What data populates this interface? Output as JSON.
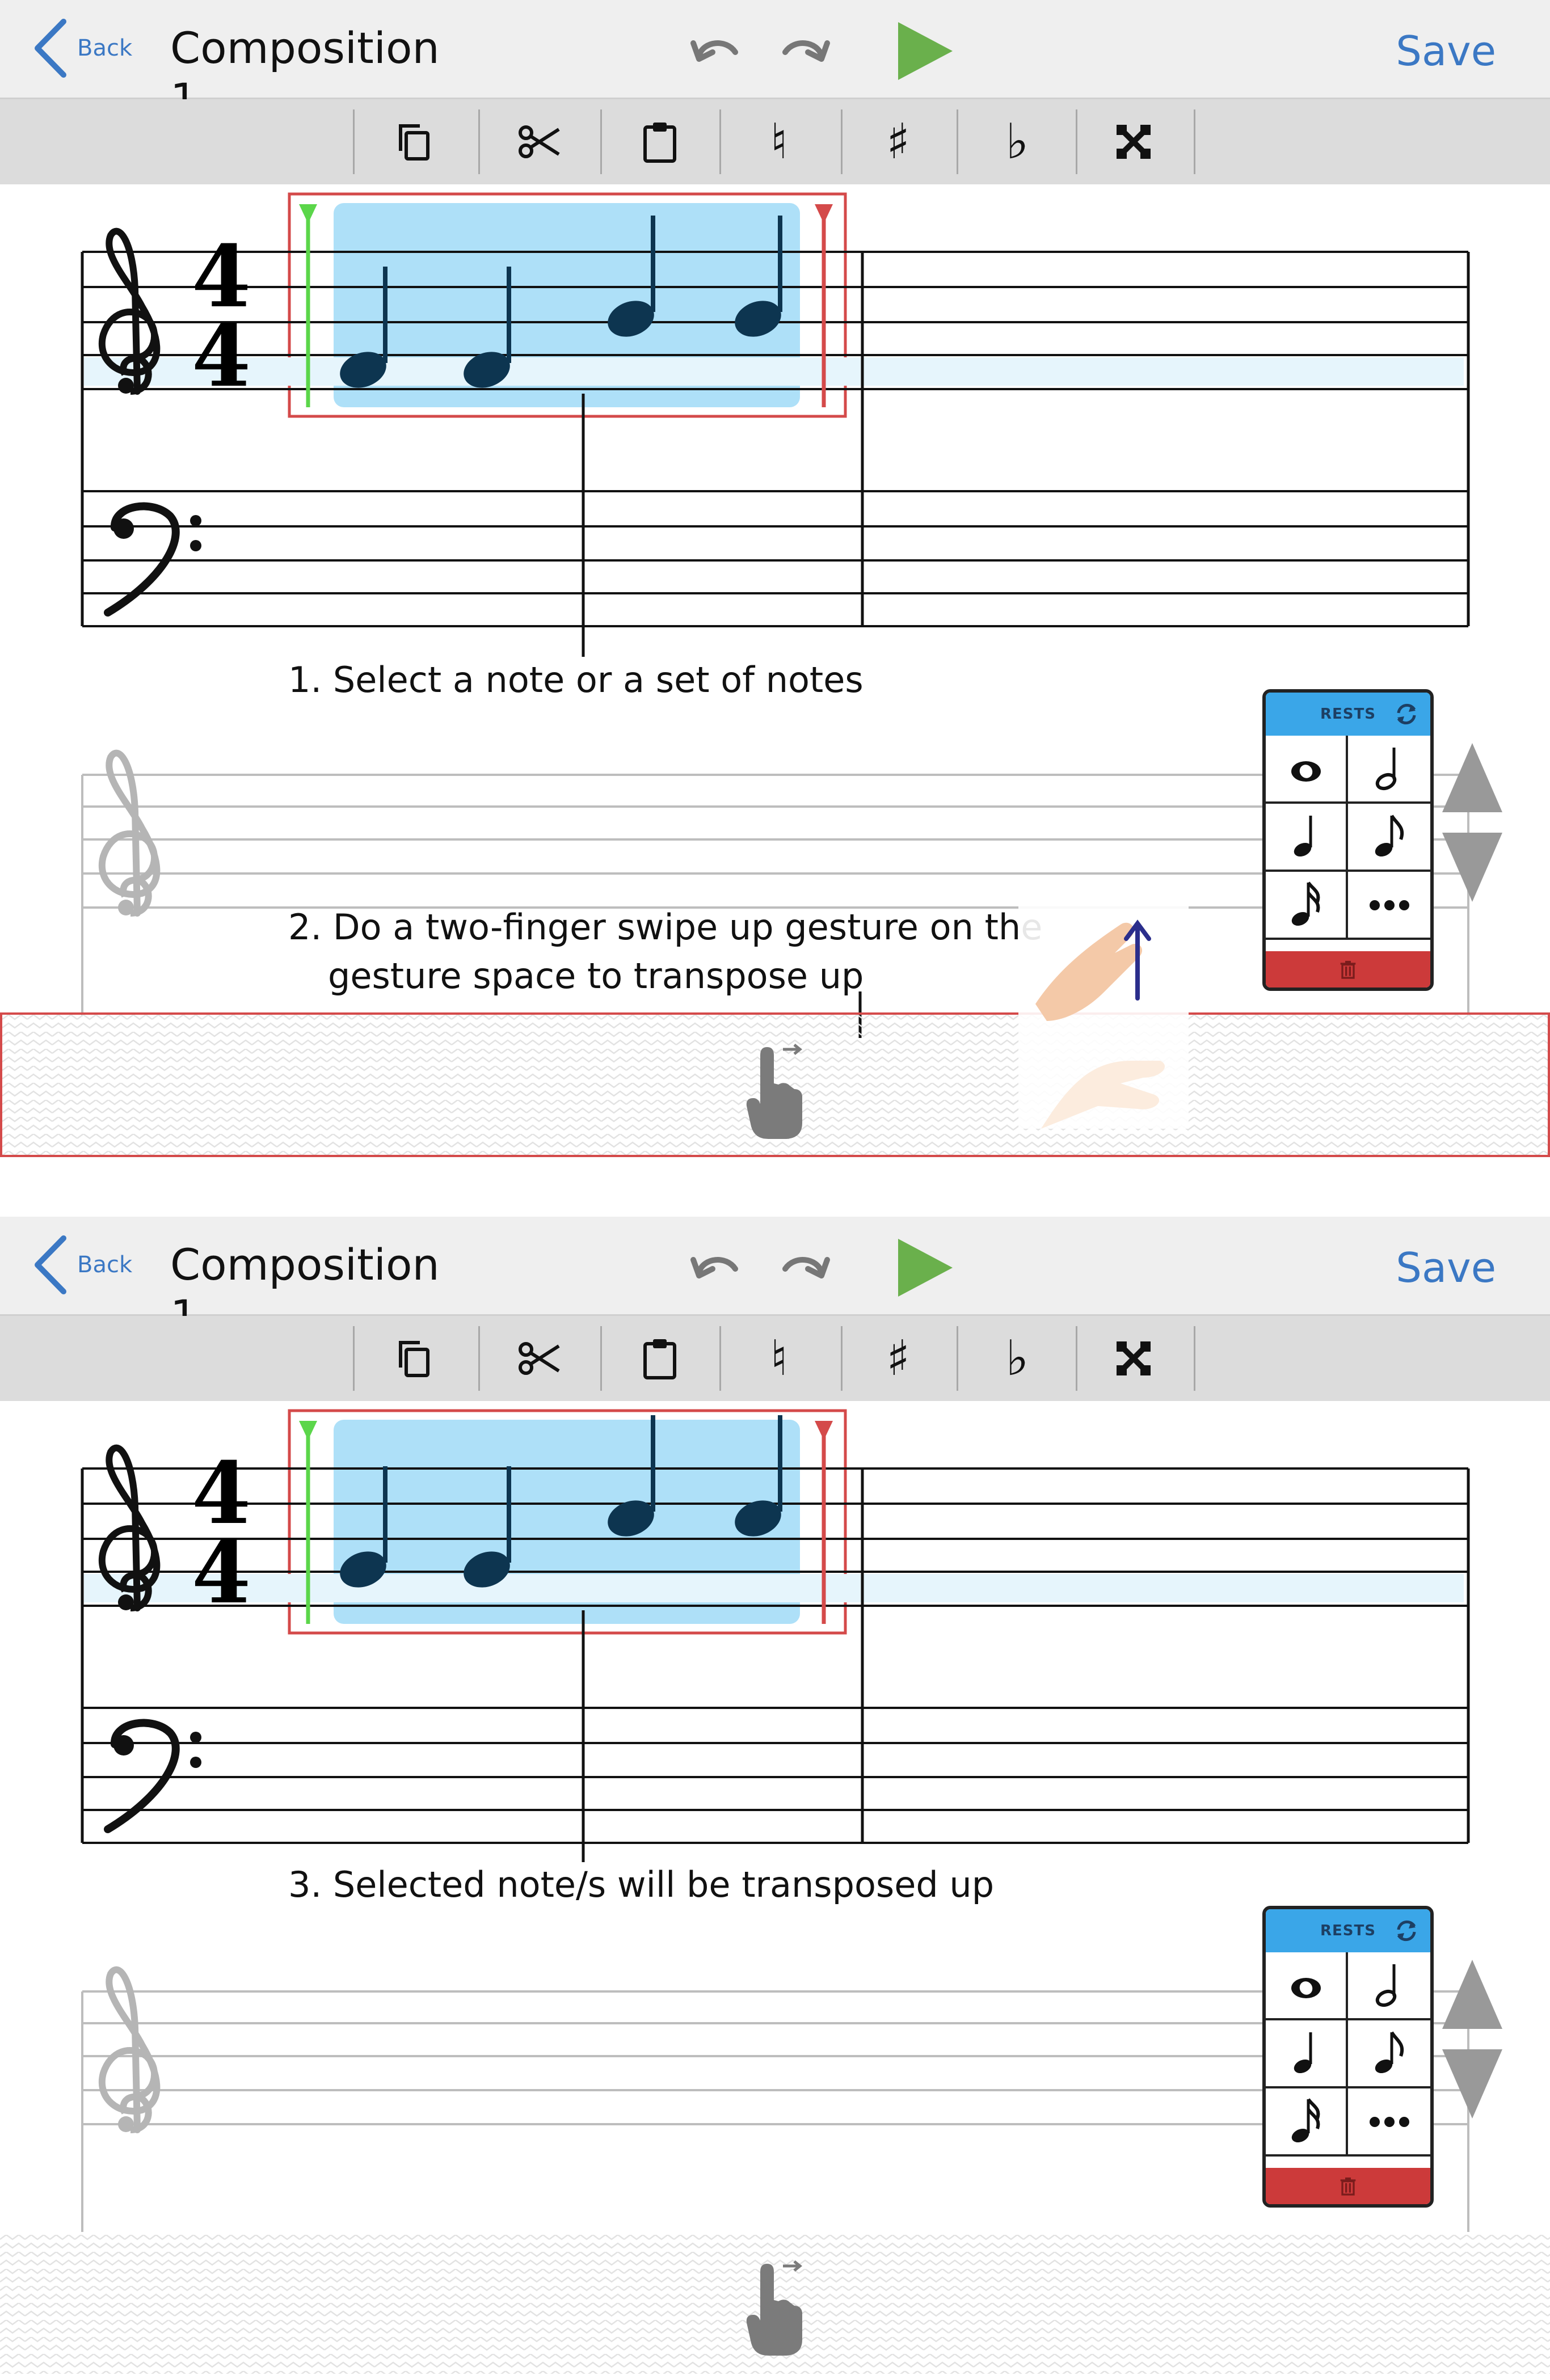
{
  "header": {
    "back_label": "Back",
    "title": "Composition 1",
    "save_label": "Save"
  },
  "toolbar": {
    "items": [
      "copy-icon",
      "scissors-icon",
      "clipboard-icon",
      "natural-icon",
      "sharp-icon",
      "flat-icon",
      "double-sharp-icon"
    ],
    "natural": "♮",
    "sharp": "♯",
    "flat": "♭"
  },
  "score": {
    "time_signature_top": "4",
    "time_signature_bottom": "4"
  },
  "palette": {
    "header_label": "RESTS"
  },
  "captions": {
    "step1": "1. Select a note or a set of notes",
    "step2_line1": "2. Do a two-finger swipe up gesture on the",
    "step2_line2": "gesture space to transpose up",
    "step3": "3. Selected note/s will be transposed up"
  },
  "colors": {
    "accent": "#3b78c4",
    "play": "#6ab04c",
    "selection_fill": "#aee0f8",
    "selection_border": "#d44a4a",
    "start_marker": "#5bd64a",
    "end_marker": "#d44a4a",
    "note": "#0d3550",
    "palette_header": "#3aa6e8",
    "palette_footer": "#cc3a3a"
  }
}
